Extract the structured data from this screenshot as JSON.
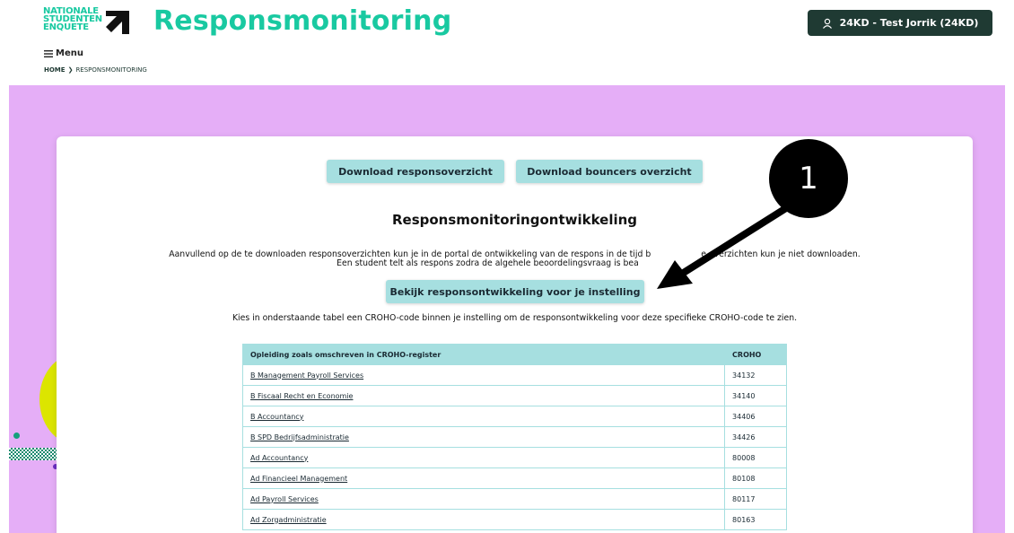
{
  "header": {
    "logo_lines": [
      "NATIONALE",
      "STUDENTEN",
      "ENQUETE"
    ],
    "title": "Responsmonitoring",
    "user_button": "24KD - Test Jorrik (24KD)",
    "menu_label": "Menu",
    "breadcrumb": {
      "home": "HOME",
      "current": "RESPONSMONITORING"
    }
  },
  "main": {
    "download_response": "Download responsoverzicht",
    "download_bouncers": "Download bouncers overzicht",
    "section_title": "Responsmonitoringontwikkeling",
    "intro_line1_a": "Aanvullend op de te downloaden responsoverzichten kun je in de portal de ontwikkeling van de respons in de tijd b",
    "intro_line1_b": "e overzichten kun je niet downloaden.",
    "intro_line2": "Een student telt als respons zodra de algehele beoordelingsvraag is bea",
    "view_button": "Bekijk responsontwikkeling voor je instelling",
    "instruction": "Kies in onderstaande tabel een CROHO-code binnen je instelling om de responsontwikkeling voor deze specifieke CROHO-code te zien."
  },
  "table": {
    "headers": {
      "name": "Opleiding zoals omschreven in CROHO-register",
      "code": "CROHO"
    },
    "rows": [
      {
        "name": "B Management Payroll Services",
        "code": "34132"
      },
      {
        "name": "B Fiscaal Recht en Economie",
        "code": "34140"
      },
      {
        "name": "B Accountancy",
        "code": "34406"
      },
      {
        "name": "B SPD Bedrijfsadministratie",
        "code": "34426"
      },
      {
        "name": "Ad Accountancy",
        "code": "80008"
      },
      {
        "name": "Ad Financieel Management",
        "code": "80108"
      },
      {
        "name": "Ad Payroll Services",
        "code": "80117"
      },
      {
        "name": "Ad Zorgadministratie",
        "code": "80163"
      }
    ]
  },
  "annotation": {
    "label": "1"
  },
  "colors": {
    "accent": "#19c9a1",
    "band": "#e5aef7",
    "button": "#a6dfe0",
    "user_button": "#1f3a33"
  }
}
